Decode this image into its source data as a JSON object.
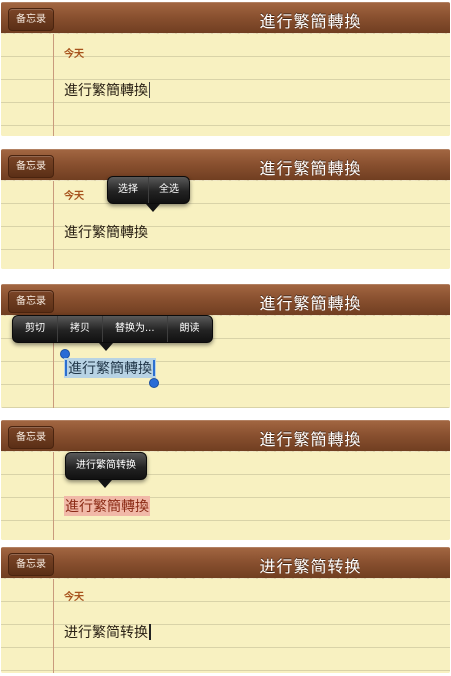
{
  "header": {
    "back_label": "备忘录"
  },
  "panels": [
    {
      "title": "進行繁簡轉換",
      "date": "今天",
      "text": "進行繁簡轉換"
    },
    {
      "title": "進行繁簡轉換",
      "date": "今天",
      "text": "進行繁簡轉換",
      "callout": [
        "选择",
        "全选"
      ]
    },
    {
      "title": "進行繁簡轉換",
      "text": "進行繁簡轉換",
      "callout": [
        "剪切",
        "拷贝",
        "替换为...",
        "朗读"
      ]
    },
    {
      "title": "進行繁簡轉換",
      "text": "進行繁簡轉換",
      "callout": [
        "进行繁简转换"
      ]
    },
    {
      "title": "进行繁简转换",
      "date": "今天",
      "text": "进行繁简转换"
    }
  ],
  "colors": {
    "leather": "#8a5130",
    "paper": "#f8f1c1",
    "date": "#a7531d",
    "selection": "#b8d3e4",
    "converted": "#f1b9a8"
  },
  "icons": {
    "selection-handle": "blue dot"
  }
}
